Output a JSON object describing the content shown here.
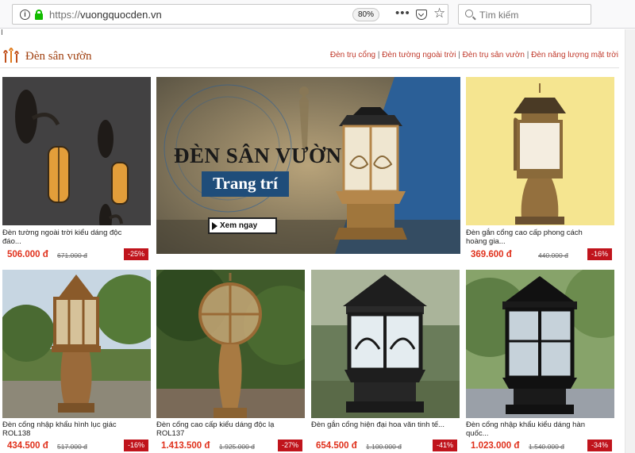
{
  "browser": {
    "url_protocol": "https://",
    "url_host": "vuongquocden.vn",
    "zoom": "80%",
    "more_glyph": "•••",
    "search_placeholder": "Tìm kiếm",
    "bookmark_fragment": "I"
  },
  "section": {
    "title": "Đèn sân vườn",
    "links": [
      "Đèn trụ cổng",
      "Đèn tường ngoài trời",
      "Đèn trụ sân vườn",
      "Đèn năng lượng mặt trời"
    ],
    "separator": "|"
  },
  "banner": {
    "title": "ĐÈN SÂN VƯỜN",
    "subtitle": "Trang trí",
    "button": "Xem ngay"
  },
  "products": [
    {
      "name_l1": "Đèn tường ngoài trời kiểu dáng độc",
      "name_l2": "đáo...",
      "price": "506.000 đ",
      "old_price": "671.000 đ",
      "discount": "-25%"
    },
    {
      "name_l1": "Đèn gắn cổng cao cấp phong cách",
      "name_l2": "hoàng gia...",
      "price": "369.600 đ",
      "old_price": "440.000 đ",
      "discount": "-16%"
    },
    {
      "name_l1": "Đèn cổng nhập khẩu hình lục giác",
      "name_l2": "ROL138",
      "price": "434.500 đ",
      "old_price": "517.000 đ",
      "discount": "-16%"
    },
    {
      "name_l1": "Đèn cổng cao cấp kiểu dáng độc lạ",
      "name_l2": "ROL137",
      "price": "1.413.500 đ",
      "old_price": "1.925.000 đ",
      "discount": "-27%"
    },
    {
      "name_l1": "Đèn gắn cổng hiện đại hoa văn tinh tế...",
      "name_l2": "",
      "price": "654.500 đ",
      "old_price": "1.100.000 đ",
      "discount": "-41%"
    },
    {
      "name_l1": "Đèn cổng nhập khẩu kiểu dáng hàn",
      "name_l2": "quốc...",
      "price": "1.023.000 đ",
      "old_price": "1.540.000 đ",
      "discount": "-34%"
    }
  ],
  "colors": {
    "price": "#e0311c",
    "discount_bg": "#c0141c",
    "section_title": "#a04010",
    "banner_sub_bg": "#1f4d7a"
  }
}
